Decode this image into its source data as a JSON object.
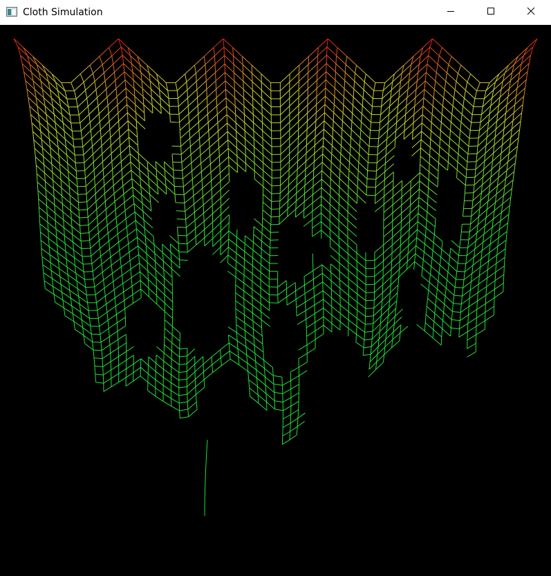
{
  "window": {
    "title": "Cloth Simulation",
    "icon": "app-window-icon"
  },
  "caption_buttons": [
    {
      "name": "minimize",
      "icon": "minimize-icon"
    },
    {
      "name": "maximize",
      "icon": "maximize-icon"
    },
    {
      "name": "close",
      "icon": "close-icon"
    }
  ],
  "canvas": {
    "background": "#000000",
    "colors": {
      "low_stress": "#22e03a",
      "mid_stress": "#c8d838",
      "high_stress": "#e01818"
    }
  }
}
